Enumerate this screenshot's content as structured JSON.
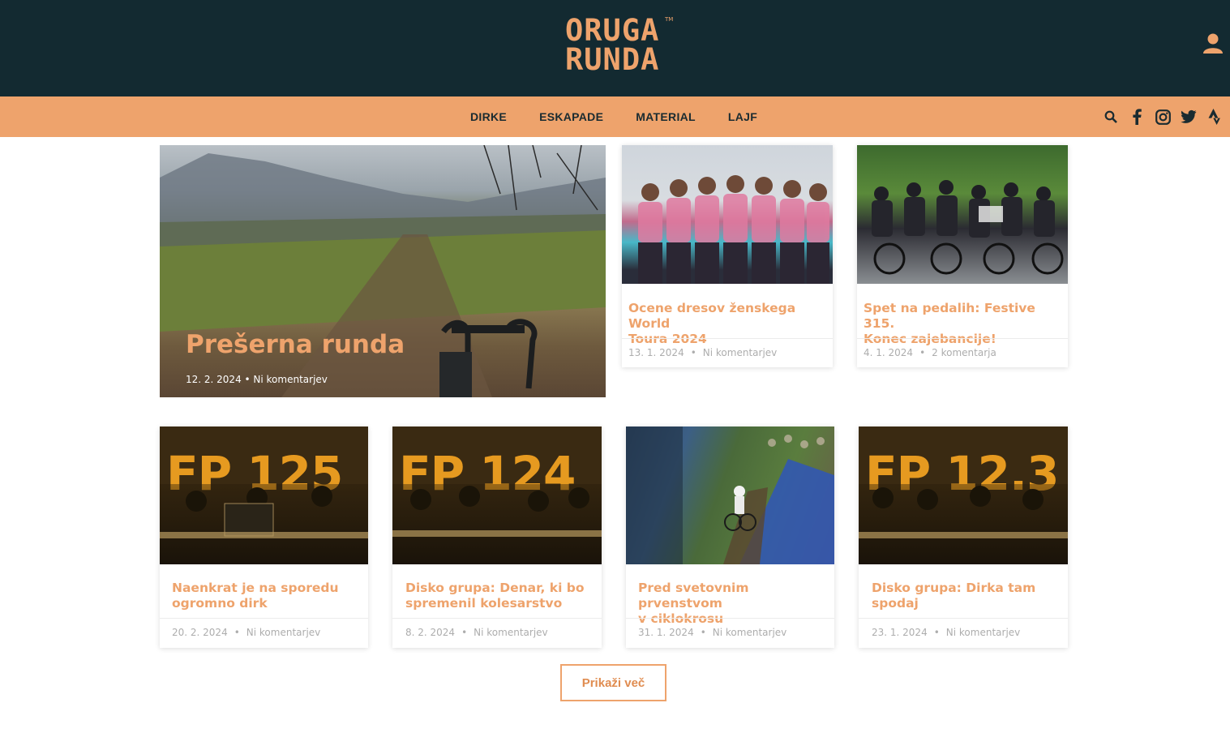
{
  "header": {
    "logo_line1": "ORUGA",
    "logo_line2": "RUNDA",
    "logo_tm": "TM"
  },
  "nav": {
    "items": [
      "DIRKE",
      "ESKAPADE",
      "MATERIAL",
      "LAJF"
    ]
  },
  "featured": {
    "title": "Prešerna runda",
    "meta": "12. 2. 2024 • Ni komentarjev"
  },
  "top_cards": [
    {
      "title_line1": "Ocene dresov ženskega World",
      "title_line2": "Toura 2024",
      "date": "13. 1. 2024",
      "comments": "Ni komentarjev"
    },
    {
      "title_line1": "Spet na pedalih: Festive 315.",
      "title_line2": "Konec zajebancije!",
      "date": "4. 1. 2024",
      "comments": "2 komentarja"
    }
  ],
  "bottom_cards": [
    {
      "overlay": "FP 125",
      "title_line1": "Naenkrat je na sporedu",
      "title_line2": "ogromno dirk",
      "date": "20. 2. 2024",
      "comments": "Ni komentarjev"
    },
    {
      "overlay": "FP 124",
      "title_line1": "Disko grupa: Denar, ki bo",
      "title_line2": "spremenil kolesarstvo",
      "date": "8. 2. 2024",
      "comments": "Ni komentarjev"
    },
    {
      "overlay": "",
      "title_line1": "Pred svetovnim prvenstvom",
      "title_line2": "v ciklokrosu",
      "date": "31. 1. 2024",
      "comments": "Ni komentarjev"
    },
    {
      "overlay": "FP 12.3",
      "title_line1": "Disko grupa: Dirka tam",
      "title_line2": "spodaj",
      "date": "23. 1. 2024",
      "comments": "Ni komentarjev"
    }
  ],
  "load_more": "Prikaži več",
  "colors": {
    "header_bg": "#132a31",
    "accent": "#eea36c",
    "nav_text": "#1a2b30",
    "meta_gray": "#adadad"
  },
  "icons": [
    "user-icon",
    "search-icon",
    "facebook-icon",
    "instagram-icon",
    "twitter-icon",
    "strava-icon"
  ]
}
